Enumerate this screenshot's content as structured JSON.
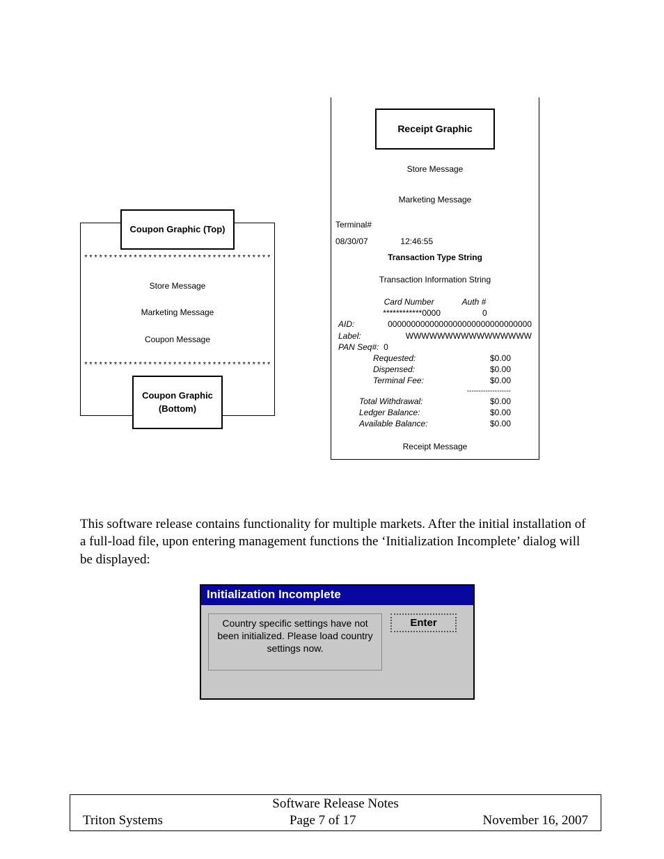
{
  "coupon": {
    "top_graphic": "Coupon Graphic (Top)",
    "stars": "**************************************",
    "store_message": "Store Message",
    "marketing_message": "Marketing Message",
    "coupon_message": "Coupon Message",
    "bottom_graphic_line1": "Coupon Graphic",
    "bottom_graphic_line2": "(Bottom)"
  },
  "receipt": {
    "graphic": "Receipt Graphic",
    "store_message": "Store Message",
    "marketing_message": "Marketing Message",
    "terminal_label": "Terminal#",
    "date": "08/30/07",
    "time": "12:46:55",
    "transaction_type": "Transaction Type String",
    "transaction_info": "Transaction Information String",
    "card_number_label": "Card Number",
    "auth_label": "Auth #",
    "card_number_value": "************0000",
    "auth_value": "0",
    "aid_label": "AID:",
    "aid_value": "0000000000000000000000000000000",
    "label_label": "Label:",
    "label_value": "WWWWWWWWWWWWWWWW",
    "panseq_label": "PAN Seq#:",
    "panseq_value": "0",
    "requested_label": "Requested:",
    "requested_value": "$0.00",
    "dispensed_label": "Dispensed:",
    "dispensed_value": "$0.00",
    "terminal_fee_label": "Terminal Fee:",
    "terminal_fee_value": "$0.00",
    "dashes": "-------------------",
    "total_withdrawal_label": "Total Withdrawal:",
    "total_withdrawal_value": "$0.00",
    "ledger_balance_label": "Ledger Balance:",
    "ledger_balance_value": "$0.00",
    "available_balance_label": "Available Balance:",
    "available_balance_value": "$0.00",
    "receipt_message": "Receipt Message"
  },
  "body_paragraph": "This software release contains functionality for multiple markets.  After the initial installation of a full-load file, upon entering management functions the ‘Initialization Incomplete’ dialog will be displayed:",
  "dialog": {
    "title": "Initialization Incomplete",
    "message": "Country specific settings have not been initialized.  Please load country settings now.",
    "button": "Enter"
  },
  "footer": {
    "title": "Software Release Notes",
    "company": "Triton Systems",
    "page": "Page 7 of 17",
    "date": "November 16, 2007"
  }
}
